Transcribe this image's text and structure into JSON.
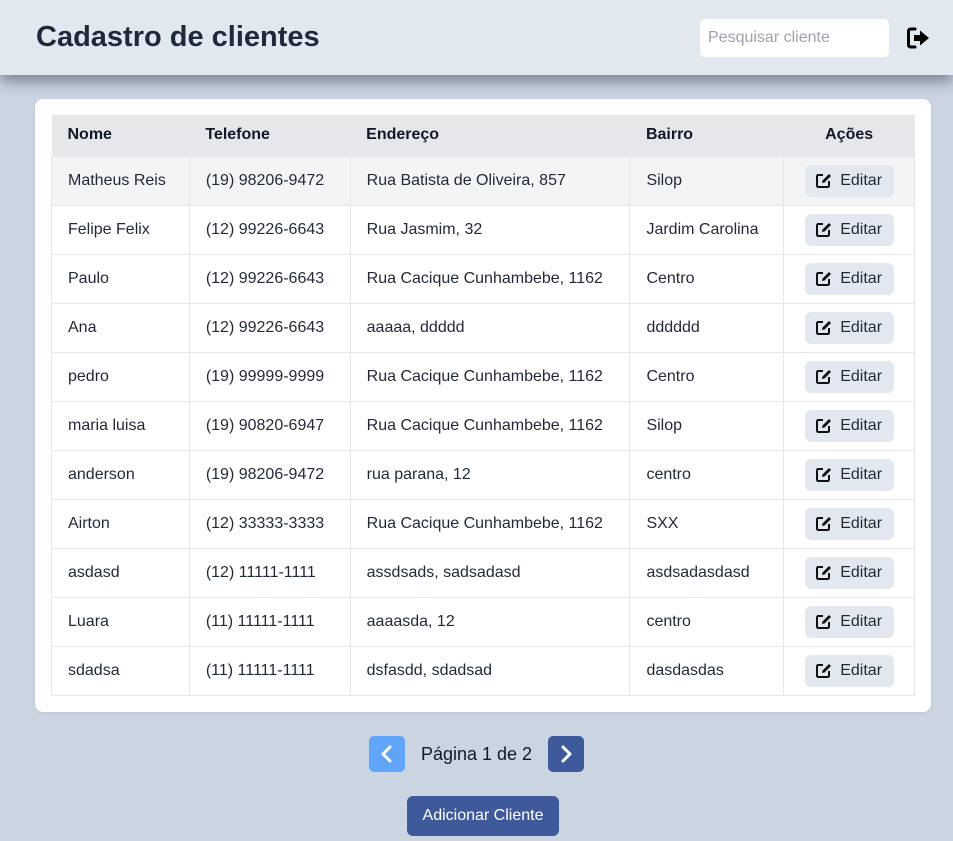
{
  "header": {
    "title": "Cadastro de clientes",
    "search_placeholder": "Pesquisar cliente",
    "logout_icon": "sign-out-icon"
  },
  "table": {
    "columns": [
      "Nome",
      "Telefone",
      "Endereço",
      "Bairro",
      "Ações"
    ],
    "edit_label": "Editar",
    "edit_icon": "edit-icon",
    "rows": [
      {
        "nome": "Matheus Reis",
        "telefone": "(19) 98206-9472",
        "endereco": "Rua Batista de Oliveira, 857",
        "bairro": "Silop"
      },
      {
        "nome": "Felipe Felix",
        "telefone": "(12) 99226-6643",
        "endereco": "Rua Jasmim, 32",
        "bairro": "Jardim Carolina"
      },
      {
        "nome": "Paulo",
        "telefone": "(12) 99226-6643",
        "endereco": "Rua Cacique Cunhambebe, 1162",
        "bairro": "Centro"
      },
      {
        "nome": "Ana",
        "telefone": "(12) 99226-6643",
        "endereco": "aaaaa, ddddd",
        "bairro": "dddddd"
      },
      {
        "nome": "pedro",
        "telefone": "(19) 99999-9999",
        "endereco": "Rua Cacique Cunhambebe, 1162",
        "bairro": "Centro"
      },
      {
        "nome": "maria luisa",
        "telefone": "(19) 90820-6947",
        "endereco": "Rua Cacique Cunhambebe, 1162",
        "bairro": "Silop"
      },
      {
        "nome": "anderson",
        "telefone": "(19) 98206-9472",
        "endereco": "rua parana, 12",
        "bairro": "centro"
      },
      {
        "nome": "Airton",
        "telefone": "(12) 33333-3333",
        "endereco": "Rua Cacique Cunhambebe, 1162",
        "bairro": "SXX"
      },
      {
        "nome": "asdasd",
        "telefone": "(12) 11111-1111",
        "endereco": "assdsads, sadsadasd",
        "bairro": "asdsadasdasd"
      },
      {
        "nome": "Luara",
        "telefone": "(11) 11111-1111",
        "endereco": "aaaasda, 12",
        "bairro": "centro"
      },
      {
        "nome": "sdadsa",
        "telefone": "(11) 11111-1111",
        "endereco": "dsfasdd, sdadsad",
        "bairro": "dasdasdas"
      }
    ]
  },
  "pagination": {
    "label": "Página 1 de 2",
    "prev_icon": "chevron-left-icon",
    "next_icon": "chevron-right-icon"
  },
  "add_button_label": "Adicionar Cliente",
  "colors": {
    "background": "#cbd5e1",
    "header": "#e2e8f0",
    "primary": "#3f5a9a",
    "prev_button": "#60a5fa"
  }
}
